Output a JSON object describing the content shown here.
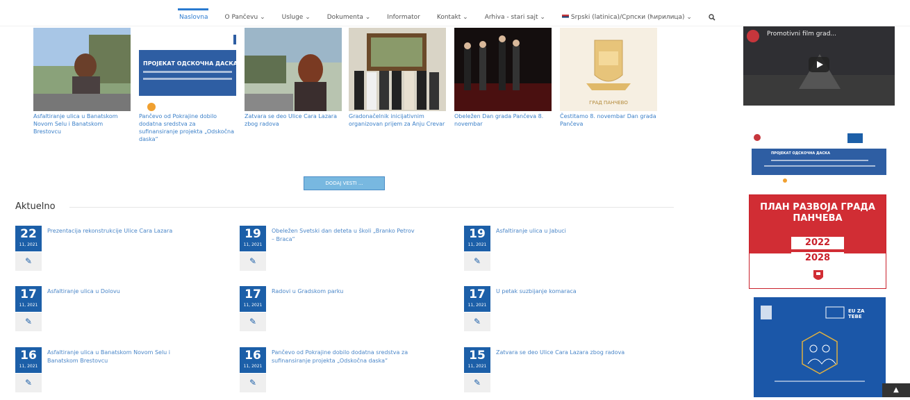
{
  "nav": {
    "items": [
      "Naslovna",
      "O Pančevu ⌄",
      "Usluge ⌄",
      "Dokumenta ⌄",
      "Informator",
      "Kontakt ⌄",
      "Arhiva - stari sajt ⌄",
      "Srpski (latinica)/Српски (ћирилица) ⌄"
    ],
    "search_icon": "search-icon"
  },
  "news": [
    {
      "caption": "Asfaltiranje ulica u Banatskom Novom Selu i Banatskom Brestovcu"
    },
    {
      "caption": "Pančevo od Pokrajine dobilo dodatna sredstva za sufinansiranje projekta „Odskočna daska“",
      "banner": "ПРОЈЕКАТ ОДСКОЧНА ДАСКА"
    },
    {
      "caption": "Zatvara se deo Ulice Cara Lazara zbog radova"
    },
    {
      "caption": "Gradonačelnik inicijativnim organizovan prijem za Anju Crevar"
    },
    {
      "caption": "Obeležen Dan grada Pančeva 8. novembar"
    },
    {
      "caption": "Čestitamo 8. novembar Dan grada Pančeva",
      "logo_text": "ГРАД ПАНЧЕВО"
    }
  ],
  "more_button": "DODAJ VESTI ...",
  "section_title": "Aktuelno",
  "events": [
    {
      "day": "22",
      "month": "11, 2021",
      "title": "Prezentacija rekonstrukcije Ulice Cara Lazara"
    },
    {
      "day": "19",
      "month": "11, 2021",
      "title": "Obeležen Svetski dan deteta u školi „Branko Petrov – Braca“"
    },
    {
      "day": "19",
      "month": "11, 2021",
      "title": "Asfaltiranje ulica u Jabuci"
    },
    {
      "day": "17",
      "month": "11, 2021",
      "title": "Asfaltiranje ulica u Dolovu"
    },
    {
      "day": "17",
      "month": "11, 2021",
      "title": "Radovi u Gradskom parku"
    },
    {
      "day": "17",
      "month": "11, 2021",
      "title": "U petak suzbijanje komaraca"
    },
    {
      "day": "16",
      "month": "11, 2021",
      "title": "Asfaltiranje ulica u Banatskom Novom Selu i Banatskom Brestovcu"
    },
    {
      "day": "16",
      "month": "11, 2021",
      "title": "Pančevo od Pokrajine dobilo dodatna sredstva za sufinansiranje projekta „Odskočna daska“"
    },
    {
      "day": "15",
      "month": "11, 2021",
      "title": "Zatvara se deo Ulice Cara Lazara zbog radova"
    }
  ],
  "sidebar": {
    "video_title": "Promotivni film grad...",
    "banner1_text": "ПРОЈЕКАТ ОДСКОЧНА ДАСКА",
    "plan_title": "ПЛАН РАЗВОЈА ГРАДА ПАНЧЕВА",
    "plan_year1": "2022",
    "plan_year2": "2028",
    "eu_label": "EU ZA TEBE"
  },
  "colors": {
    "accent": "#1c5fa8",
    "link": "#3a7fc8",
    "red": "#d12d34"
  }
}
